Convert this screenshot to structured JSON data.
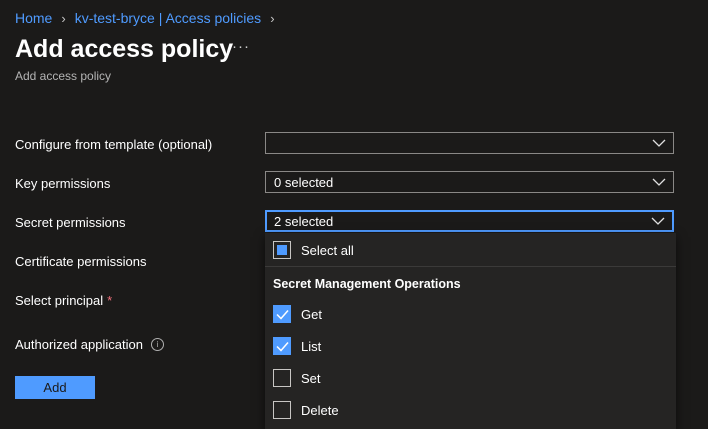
{
  "breadcrumb": {
    "items": [
      "Home",
      "kv-test-bryce | Access policies"
    ]
  },
  "header": {
    "title": "Add access policy",
    "more": "···",
    "subtitle": "Add access policy"
  },
  "form": {
    "template_label": "Configure from template (optional)",
    "template_value": "",
    "key_label": "Key permissions",
    "key_value": "0 selected",
    "secret_label": "Secret permissions",
    "secret_value": "2 selected",
    "certificate_label": "Certificate permissions",
    "principal_label": "Select principal",
    "principal_required": "*",
    "authorized_label": "Authorized application",
    "add_label": "Add"
  },
  "secret_dropdown": {
    "select_all": "Select all",
    "group_title": "Secret Management Operations",
    "options": [
      {
        "label": "Get",
        "checked": true
      },
      {
        "label": "List",
        "checked": true
      },
      {
        "label": "Set",
        "checked": false
      },
      {
        "label": "Delete",
        "checked": false
      }
    ]
  },
  "colors": {
    "accent": "#4f9bff",
    "background": "#1b1a19",
    "panel": "#252423",
    "required": "#f1707b"
  },
  "icons": {
    "chevron": "chevron-right-icon",
    "dropdown": "chevron-down-icon",
    "info": "info-icon",
    "check": "checkmark-icon"
  }
}
